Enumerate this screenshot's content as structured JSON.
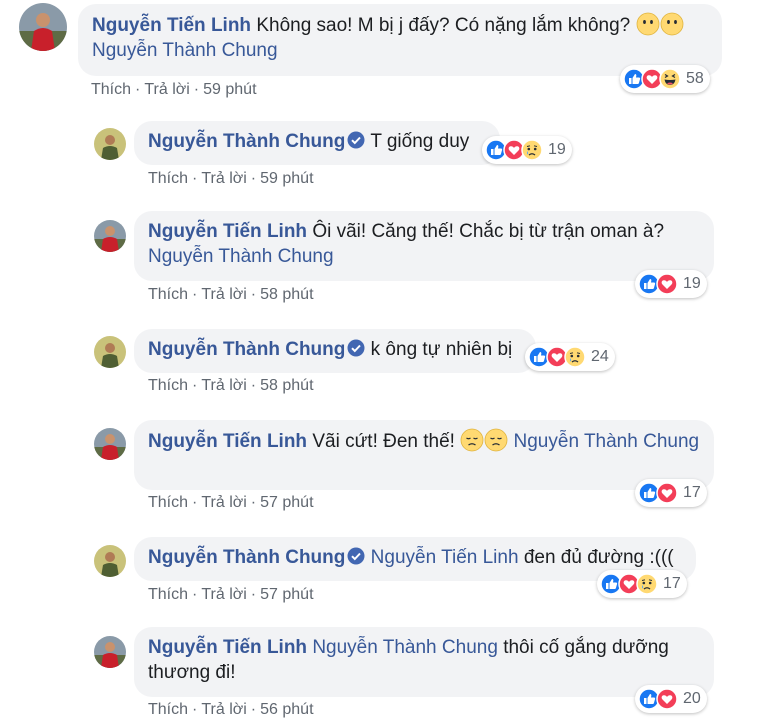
{
  "comments": [
    {
      "author": "Nguyễn Tiến Linh",
      "text": "Không sao! M bị j đấy? Có nặng lắm không?",
      "mention": "Nguyễn Thành Chung",
      "like": "Thích",
      "reply": "Trả lời",
      "time": "59 phút",
      "reactions": [
        "like",
        "love",
        "haha"
      ],
      "reaction_count": "58"
    },
    {
      "author": "Nguyễn Thành Chung",
      "text": "T giống duy",
      "like": "Thích",
      "reply": "Trả lời",
      "time": "59 phút",
      "reactions": [
        "like",
        "love",
        "sad"
      ],
      "reaction_count": "19"
    },
    {
      "author": "Nguyễn Tiến Linh",
      "text": "Ôi vãi! Căng thế! Chắc bị từ trận oman à?",
      "mention": "Nguyễn Thành Chung",
      "like": "Thích",
      "reply": "Trả lời",
      "time": "58 phút",
      "reactions": [
        "like",
        "love"
      ],
      "reaction_count": "19"
    },
    {
      "author": "Nguyễn Thành Chung",
      "text": "k ông tự nhiên bị",
      "like": "Thích",
      "reply": "Trả lời",
      "time": "58 phút",
      "reactions": [
        "like",
        "love",
        "sad"
      ],
      "reaction_count": "24"
    },
    {
      "author": "Nguyễn Tiến Linh",
      "text": "Vãi cứt! Đen thế!",
      "mention": "Nguyễn Thành Chung",
      "like": "Thích",
      "reply": "Trả lời",
      "time": "57 phút",
      "reactions": [
        "like",
        "love"
      ],
      "reaction_count": "17"
    },
    {
      "author": "Nguyễn Thành Chung",
      "mention": "Nguyễn Tiến Linh",
      "text": "đen đủ đường :(((",
      "like": "Thích",
      "reply": "Trả lời",
      "time": "57 phút",
      "reactions": [
        "like",
        "love",
        "sad"
      ],
      "reaction_count": "17"
    },
    {
      "author": "Nguyễn Tiến Linh",
      "mention": "Nguyễn Thành Chung",
      "text": "thôi cố gắng dưỡng",
      "text2": "thương đi!",
      "like": "Thích",
      "reply": "Trả lời",
      "time": "56 phút",
      "reactions": [
        "like",
        "love"
      ],
      "reaction_count": "20"
    }
  ],
  "colors": {
    "author": "#385898",
    "bubble": "#f2f3f5",
    "meta": "#606770",
    "like": "#1877f2",
    "love": "#f33e58",
    "emoji": "#ffd972"
  }
}
